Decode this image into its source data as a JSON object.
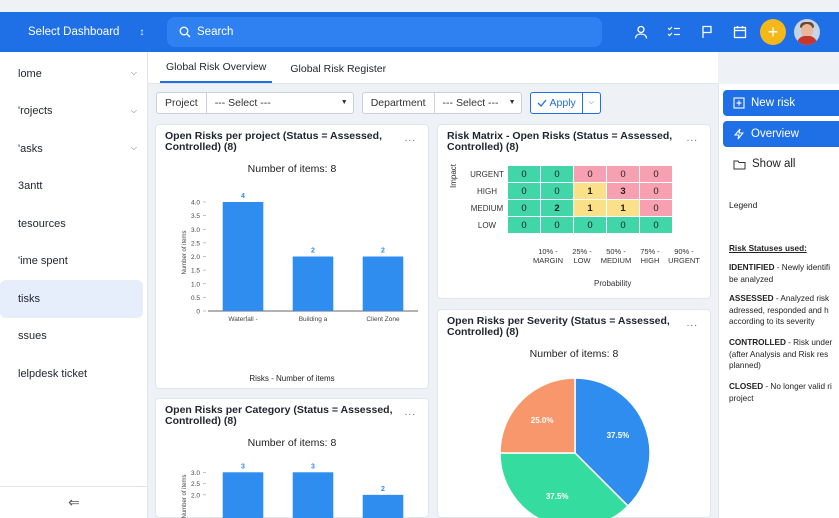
{
  "topbar": {
    "dashboard_select": "Select Dashboard",
    "search_placeholder": "Search"
  },
  "sidebar": {
    "items": [
      {
        "label": "lome"
      },
      {
        "label": "'rojects"
      },
      {
        "label": "'asks"
      },
      {
        "label": "3antt"
      },
      {
        "label": "tesources"
      },
      {
        "label": "'ime spent"
      },
      {
        "label": "tisks"
      },
      {
        "label": "ssues"
      },
      {
        "label": "lelpdesk ticket"
      }
    ]
  },
  "tabs": [
    "Global Risk Overview",
    "Global Risk Register"
  ],
  "filters": {
    "project_label": "Project",
    "project_value": "--- Select ---",
    "department_label": "Department",
    "department_value": "--- Select ---",
    "apply_label": "Apply"
  },
  "cards": {
    "per_project": {
      "title": "Open Risks per project (Status = Assessed, Controlled) (8)",
      "subtitle": "Number of items: 8",
      "footer": "Risks - Number of items"
    },
    "matrix": {
      "title": "Risk Matrix - Open Risks (Status = Assessed, Controlled) (8)"
    },
    "severity": {
      "title": "Open Risks per Severity (Status = Assessed, Controlled) (8)",
      "subtitle": "Number of items: 8"
    },
    "category": {
      "title": "Open Risks per Category (Status = Assessed, Controlled) (8)",
      "subtitle": "Number of items: 8"
    },
    "menu_glyph": "..."
  },
  "matrix": {
    "rows": [
      {
        "label": "URGENT",
        "values": [
          "0",
          "0",
          "0",
          "0",
          "0"
        ]
      },
      {
        "label": "HIGH",
        "values": [
          "0",
          "0",
          "1",
          "3",
          "0"
        ]
      },
      {
        "label": "MEDIUM",
        "values": [
          "0",
          "2",
          "1",
          "1",
          "0"
        ]
      },
      {
        "label": "LOW",
        "values": [
          "0",
          "0",
          "0",
          "0",
          "0"
        ]
      }
    ],
    "columns": [
      "10% - MARGIN",
      "25% - LOW",
      "50% - MEDIUM",
      "75% - HIGH",
      "90% - URGENT"
    ],
    "x_label": "Probability",
    "y_label": "Impact",
    "colors": {
      "green": "#40d6a8",
      "yellow": "#fbe08a",
      "pink": "#f7a0b2"
    }
  },
  "right_panel": {
    "new_risk": "New risk",
    "overview": "Overview",
    "show_all": "Show all",
    "legend": "Legend",
    "statuses_title": "Risk Statuses used:",
    "statuses": [
      {
        "name": "IDENTIFIED",
        "desc": " - Newly identifi be analyzed"
      },
      {
        "name": "ASSESSED",
        "desc": " - Analyzed risk adressed, responded and h according to its severity"
      },
      {
        "name": "CONTROLLED",
        "desc": " - Risk under (after Analysis and Risk res planned)"
      },
      {
        "name": "CLOSED",
        "desc": " - No longer valid ri project"
      }
    ]
  },
  "colors": {
    "accent": "#1f6fe6",
    "bar": "#2f8df0",
    "plus": "#f5b81b"
  },
  "chart_data": [
    {
      "type": "bar",
      "categories": [
        "Waterfall -",
        "Building a",
        "Client Zone"
      ],
      "values": [
        4,
        2,
        2
      ],
      "title": "Open Risks per project (Status = Assessed, Controlled) (8)",
      "xlabel": "Risks - Number of items",
      "ylabel": "Number of items",
      "ylim": [
        0,
        4
      ],
      "yticks": [
        "4.0",
        "3.5",
        "3.0",
        "2.5",
        "2.0",
        "1.5",
        "1.0",
        "0.5",
        "0"
      ]
    },
    {
      "type": "pie",
      "labels": [
        "37.5%",
        "37.5%",
        "25.0%"
      ],
      "values": [
        37.5,
        37.5,
        25.0
      ],
      "colors": [
        "#2f8df0",
        "#35dca0",
        "#f7976b"
      ],
      "title": "Open Risks per Severity (Status = Assessed, Controlled) (8)"
    },
    {
      "type": "bar",
      "categories": [
        "",
        "",
        ""
      ],
      "values": [
        3,
        3,
        2
      ],
      "title": "Open Risks per Category (Status = Assessed, Controlled) (8)",
      "ylabel": "Number of items",
      "yticks": [
        "3.0",
        "2.5",
        "2.0"
      ]
    }
  ]
}
